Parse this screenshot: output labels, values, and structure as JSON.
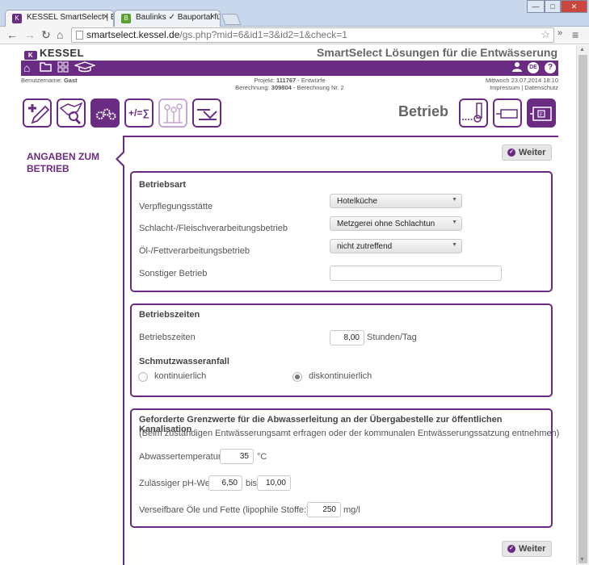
{
  "browser": {
    "tabs": [
      {
        "title": "KESSEL SmartSelect | Be",
        "close": "×"
      },
      {
        "title": "Baulinks ✓ Bauportal fü",
        "close": "×"
      }
    ],
    "url_host": "smartselect.kessel.de",
    "url_path": "/gs.php?mid=6&id1=3&id2=1&check=1",
    "window_buttons": [
      "—",
      "□",
      "✕"
    ]
  },
  "site": {
    "logo": "KESSEL",
    "title": "SmartSelect Lösungen für die Entwässerung",
    "lang_badge": "DE",
    "help_badge": "?"
  },
  "info": {
    "user_label": "Benutzername:",
    "user_value": "Gast",
    "project_label": "Projekt:",
    "project_value": "111767",
    "project_suffix": "- Entwürfe",
    "calc_label": "Berechnung:",
    "calc_value": "309804",
    "calc_suffix": "- Berechnung Nr. 2",
    "date": "Mittwoch 23.07.2014 18:10",
    "links": "Impressum | Datenschutz"
  },
  "steps": {
    "heading": "Betrieb",
    "calc_symbol": "+/=∑"
  },
  "sidebar": {
    "label_line1": "ANGABEN ZUM",
    "label_line2": "BETRIEB"
  },
  "buttons": {
    "weiter": "Weiter"
  },
  "betriebsart": {
    "title": "Betriebsart",
    "verpflegung_label": "Verpflegungsstätte",
    "verpflegung_value": "Hotelküche",
    "schlacht_label": "Schlacht-/Fleischverarbeitungsbetrieb",
    "schlacht_value": "Metzgerei ohne Schlachtun",
    "oel_label": "Öl-/Fettverarbeitungsbetrieb",
    "oel_value": "nicht zutreffend",
    "sonstiger_label": "Sonstiger Betrieb",
    "sonstiger_value": ""
  },
  "betriebszeiten": {
    "title": "Betriebszeiten",
    "label": "Betriebszeiten",
    "value": "8,00",
    "unit": "Stunden/Tag",
    "schmutz_title": "Schmutzwasseranfall",
    "opt_kont": "kontinuierlich",
    "opt_diskont": "diskontinuierlich",
    "selected": "diskontinuierlich"
  },
  "grenzwerte": {
    "title": "Geforderte Grenzwerte für die Abwasserleitung an der Übergabestelle zur öffentlichen Kanalisation",
    "subtitle": "(Beim zuständigen Entwässerungsamt erfragen oder der kommunalen Entwässerungssatzung entnehmen)",
    "temp_label": "Abwassertemperatur: ≤",
    "temp_value": "35",
    "temp_unit": "°C",
    "ph_label": "Zulässiger pH-Wert:",
    "ph_min": "6,50",
    "ph_bis": "bis",
    "ph_max": "10,00",
    "oel_label": "Verseifbare Öle und Fette (lipophile Stoffe:) max",
    "oel_value": "250",
    "oel_unit": "mg/l"
  }
}
